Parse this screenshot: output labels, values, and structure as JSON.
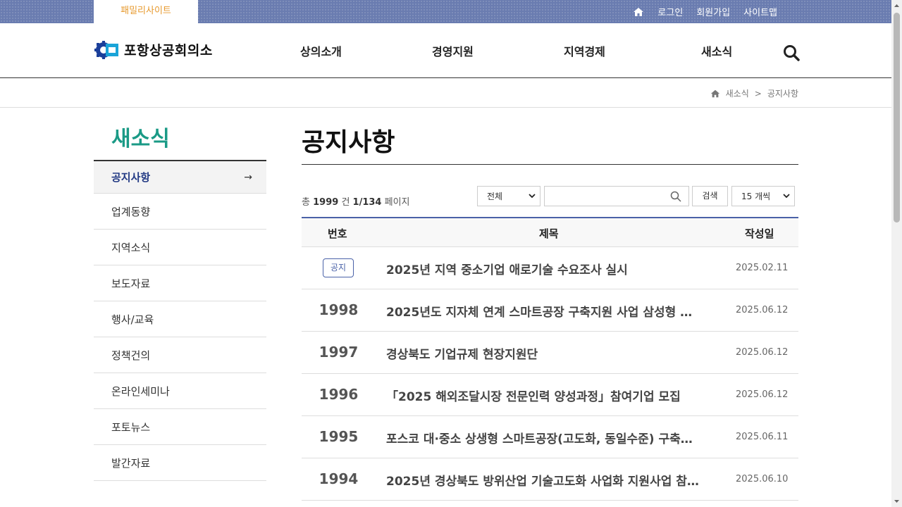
{
  "topbar": {
    "family_site": "패밀리사이트",
    "links": [
      "로그인",
      "회원가입",
      "사이트맵"
    ]
  },
  "header": {
    "logo_text": "포항상공회의소",
    "nav": [
      "상의소개",
      "경영지원",
      "지역경제",
      "새소식"
    ]
  },
  "breadcrumb": {
    "items": [
      "새소식",
      "공지사항"
    ],
    "separator": ">"
  },
  "sidebar": {
    "title": "새소식",
    "items": [
      {
        "label": "공지사항",
        "active": true
      },
      {
        "label": "업계동향"
      },
      {
        "label": "지역소식"
      },
      {
        "label": "보도자료"
      },
      {
        "label": "행사/교육"
      },
      {
        "label": "정책건의"
      },
      {
        "label": "온라인세미나"
      },
      {
        "label": "포토뉴스"
      },
      {
        "label": "발간자료"
      }
    ],
    "active_arrow": "→"
  },
  "main": {
    "title": "공지사항",
    "count": {
      "prefix": "총",
      "total": "1999",
      "unit": "건",
      "page": "1/134",
      "page_label": "페이지"
    },
    "filter_select": "전체",
    "search_placeholder": "",
    "search_button": "검색",
    "per_page_select": "15 개씩"
  },
  "table": {
    "headers": {
      "num": "번호",
      "title": "제목",
      "date": "작성일"
    },
    "rows": [
      {
        "num": "",
        "badge": "공지",
        "title": "2025년 지역 중소기업 애로기술 수요조사 실시",
        "date": "2025.02.11"
      },
      {
        "num": "1998",
        "badge": "",
        "title": "2025년도 지자체 연계 스마트공장 구축지원 사업 삼성형 …",
        "date": "2025.06.12"
      },
      {
        "num": "1997",
        "badge": "",
        "title": "경상북도 기업규제 현장지원단",
        "date": "2025.06.12"
      },
      {
        "num": "1996",
        "badge": "",
        "title": "「2025 해외조달시장 전문인력 양성과정」참여기업 모집",
        "date": "2025.06.12"
      },
      {
        "num": "1995",
        "badge": "",
        "title": "포스코 대·중소 상생형 스마트공장(고도화, 동일수준) 구축…",
        "date": "2025.06.11"
      },
      {
        "num": "1994",
        "badge": "",
        "title": "2025년 경상북도 방위산업 기술고도화 사업화 지원사업 참…",
        "date": "2025.06.10"
      }
    ]
  },
  "colors": {
    "topbar": "#6a7cb0",
    "family_tab_text": "#e79a2f",
    "side_title": "#1a9a86",
    "active_item": "#233a84",
    "table_border": "#4a62a8"
  },
  "icons": [
    "home-icon",
    "search-icon",
    "arrow-right-icon",
    "chevron-down-icon"
  ]
}
